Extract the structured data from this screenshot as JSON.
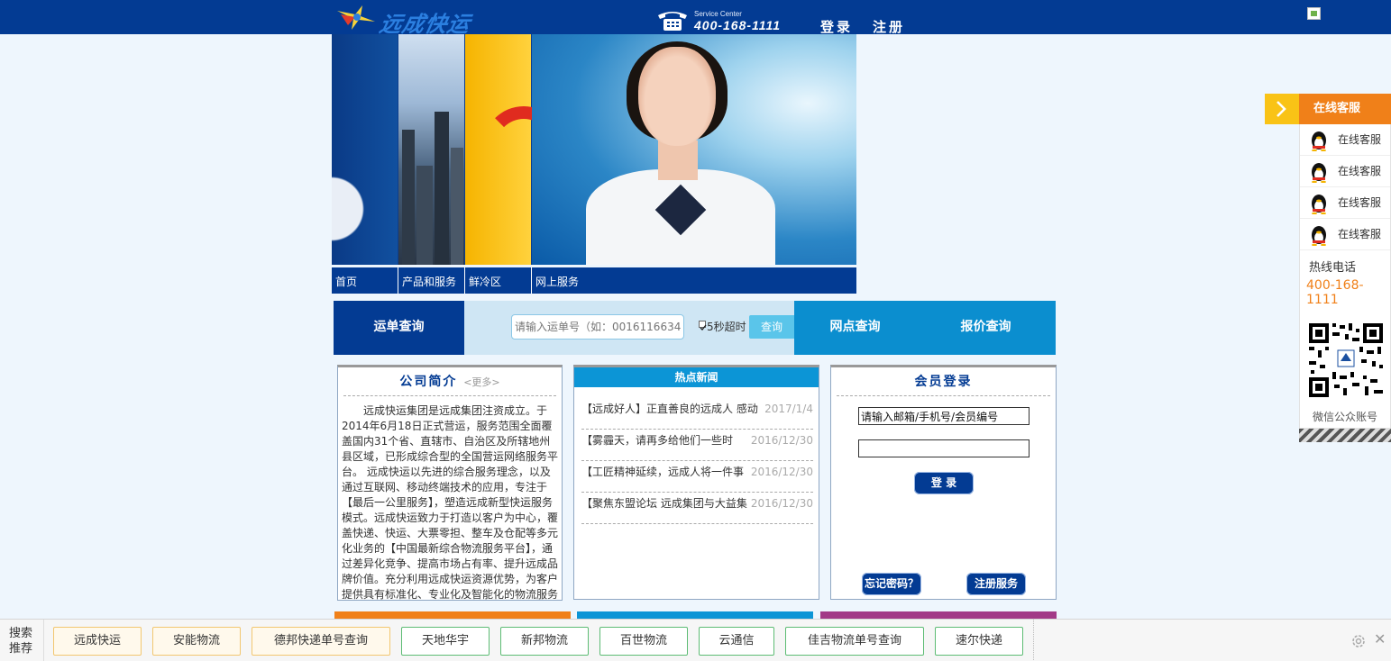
{
  "header": {
    "logo_text": "远成快运",
    "service_label": "Service Center",
    "service_phone": "400-168-1111",
    "login_link": "登录",
    "register_link": "注册"
  },
  "nav": [
    {
      "label": "首页"
    },
    {
      "label": "产品和服务"
    },
    {
      "label": "鲜冷区"
    },
    {
      "label": "网上服务"
    }
  ],
  "query": {
    "tab_waybill": "运单查询",
    "input_placeholder": "请输入运单号（如：0016116634）",
    "checkbox_label": "5秒超时",
    "checkbox_checked": true,
    "search_button": "查询",
    "tab_outlets": "网点查询",
    "tab_quote": "报价查询"
  },
  "intro": {
    "title": "公司简介",
    "more": "<更多>",
    "text": "远成快运集团是远成集团注资成立。于2014年6月18日正式营运，服务范围全面覆盖国内31个省、直辖市、自治区及所辖地州县区域，已形成综合型的全国营运网络服务平台。 远成快运以先进的综合服务理念，以及通过互联网、移动终端技术的应用，专注于【最后一公里服务】，塑造远成新型快运服务模式。远成快运致力于打造以客户为中心，覆盖快递、快运、大票零担、整车及仓配等多元化业务的【中国最新综合物流服务平台】，通过差异化竞争、提高市场占有率、提升远成品牌价值。充分利用远成快运资源优势，为客户提供具有标准化、专业化及智能化的物流服务体验。 远成快运集团拥有员工人"
  },
  "news": {
    "title": "热点新闻",
    "items": [
      {
        "title": "【远成好人】正直善良的远成人 感动",
        "date": "2017/1/4"
      },
      {
        "title": "【雾霾天，请再多给他们一些时",
        "date": "2016/12/30"
      },
      {
        "title": "【工匠精神延续，远成人将一件事",
        "date": "2016/12/30"
      },
      {
        "title": "【聚焦东盟论坛 远成集团与大益集",
        "date": "2016/12/30"
      }
    ]
  },
  "member": {
    "title": "会员登录",
    "username_value": "请输入邮箱/手机号/会员编号",
    "password_value": "",
    "login_button": "登 录",
    "forgot_button": "忘记密码？",
    "register_button": "注册服务"
  },
  "float_panel": {
    "header": "在线客服",
    "qq_items": [
      "在线客服",
      "在线客服",
      "在线客服",
      "在线客服"
    ],
    "hotline_label": "热线电话",
    "hotline_number": "400-168-1111",
    "wechat_label": "微信公众账号"
  },
  "search_bar": {
    "label": "搜索推荐",
    "tags": [
      "远成快运",
      "安能物流",
      "德邦快递单号查询",
      "天地华宇",
      "新邦物流",
      "百世物流",
      "云通信",
      "佳吉物流单号查询",
      "速尔快递"
    ]
  },
  "colors": {
    "brand_blue": "#033b93",
    "accent_cyan": "#0c95d6",
    "accent_orange": "#f08019"
  }
}
